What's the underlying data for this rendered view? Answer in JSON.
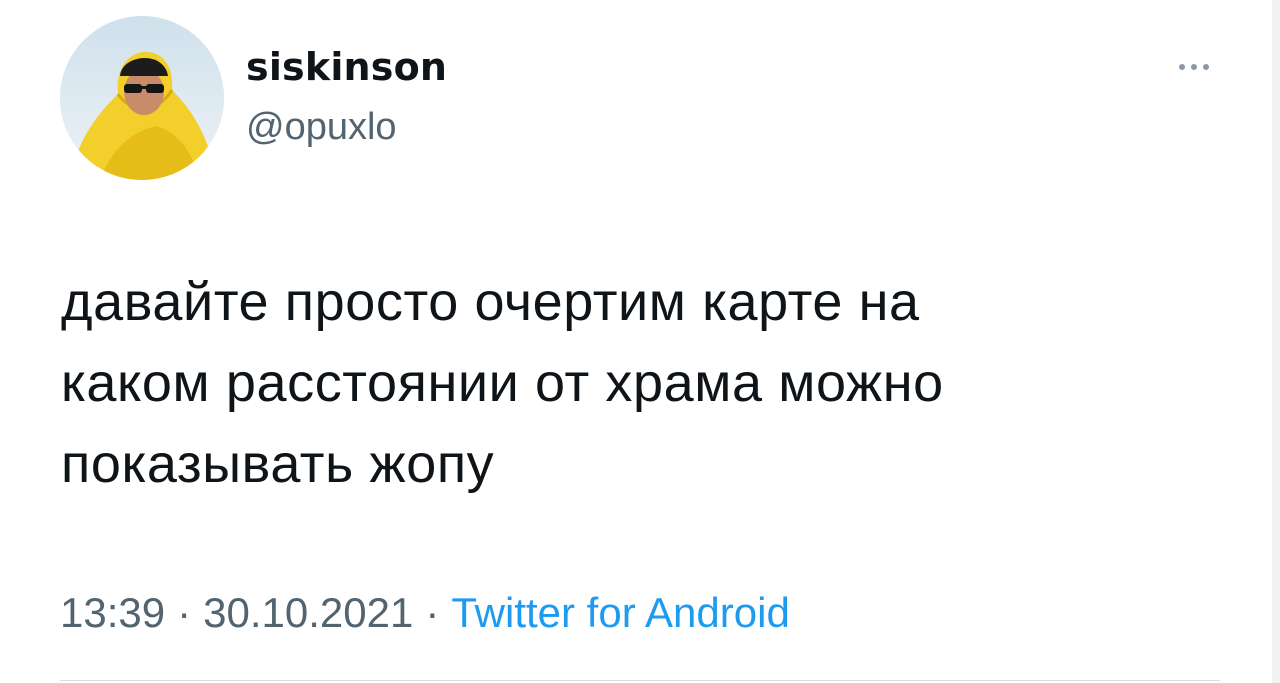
{
  "tweet": {
    "author": {
      "display_name": "siskinson",
      "handle": "@opuxlo",
      "avatar_icon": "avatar-person-in-yellow-blanket"
    },
    "text": "давайте просто очертим карте на\nкаком расстоянии от храма можно\nпоказывать жопу",
    "time": "13:39",
    "separator": "·",
    "date": "30.10.2021",
    "source": "Twitter for Android",
    "more_icon": "more-dots-icon"
  },
  "colors": {
    "text_primary": "#0f1419",
    "text_secondary": "#536471",
    "link": "#1d9bf0"
  }
}
